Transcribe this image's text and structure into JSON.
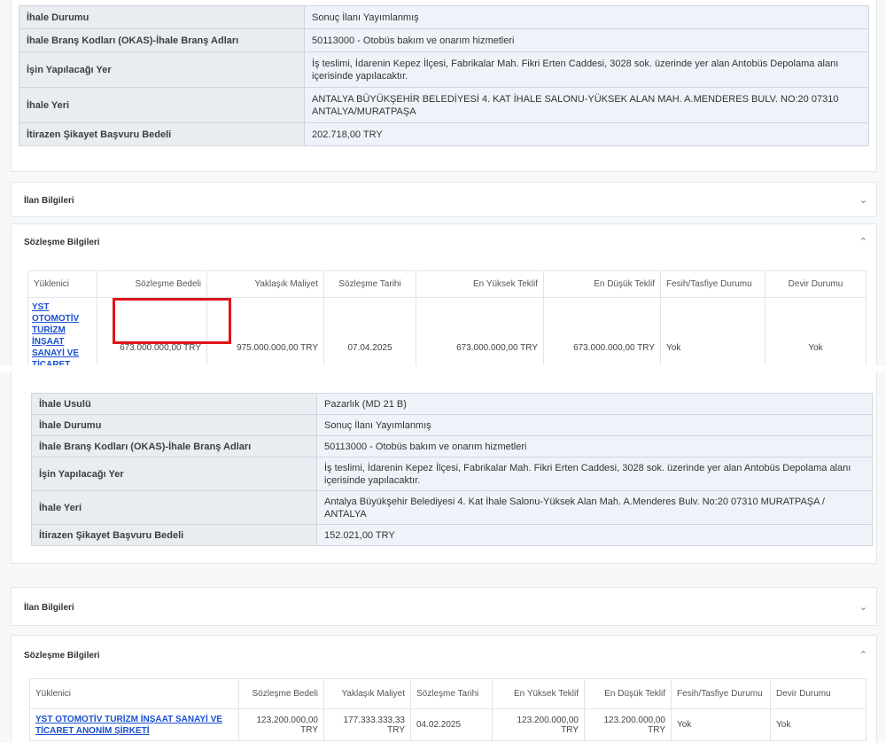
{
  "panel1": {
    "info_rows": [
      {
        "label": "İhale Durumu",
        "value": "Sonuç İlanı Yayımlanmış"
      },
      {
        "label": "İhale Branş Kodları (OKAS)-İhale Branş Adları",
        "value": "50113000 - Otobüs bakım ve onarım hizmetleri"
      },
      {
        "label": "İşin Yapılacağı Yer",
        "value": "İş teslimi, İdarenin Kepez İlçesi, Fabrikalar Mah. Fikri Erten Caddesi, 3028 sok. üzerinde yer alan Antobüs Depolama alanı içerisinde yapılacaktır."
      },
      {
        "label": "İhale Yeri",
        "value": "ANTALYA BÜYÜKŞEHİR BELEDİYESİ 4. KAT İHALE SALONU-YÜKSEK ALAN MAH. A.MENDERES BULV. NO:20 07310 ANTALYA/MURATPAŞA"
      },
      {
        "label": "İtirazen Şikayet Başvuru Bedeli",
        "value": "202.718,00 TRY"
      }
    ],
    "ilan_title": "İlan Bilgileri",
    "sozlesme_title": "Sözleşme Bilgileri",
    "contract_headers": [
      "Yüklenici",
      "Sözleşme Bedeli",
      "Yaklaşık Maliyet",
      "Sözleşme Tarihi",
      "En Yüksek Teklif",
      "En Düşük Teklif",
      "Fesih/Tasfiye Durumu",
      "Devir Durumu"
    ],
    "contract_row": {
      "contractor": "YST OTOMOTİV TURİZM İNŞAAT SANAYİ VE TİCARET ANONİM ŞİRKETİ",
      "contract_price": "673.000.000,00 TRY",
      "approx_cost": "975.000.000,00 TRY",
      "date": "07.04.2025",
      "highest_bid": "673.000.000,00 TRY",
      "lowest_bid": "673.000.000,00 TRY",
      "termination": "Yok",
      "transfer": "Yok"
    }
  },
  "panel2": {
    "info_rows": [
      {
        "label": "İhale Usulü",
        "value": "Pazarlık (MD 21 B)"
      },
      {
        "label": "İhale Durumu",
        "value": "Sonuç İlanı Yayımlanmış"
      },
      {
        "label": "İhale Branş Kodları (OKAS)-İhale Branş Adları",
        "value": "50113000 - Otobüs bakım ve onarım hizmetleri"
      },
      {
        "label": "İşin Yapılacağı Yer",
        "value": "İş teslimi, İdarenin Kepez İlçesi, Fabrikalar Mah. Fikri Erten Caddesi, 3028 sok. üzerinde yer alan Antobüs Depolama alanı içerisinde yapılacaktır."
      },
      {
        "label": "İhale Yeri",
        "value": "Antalya Büyükşehir Belediyesi 4. Kat İhale Salonu-Yüksek Alan Mah. A.Menderes Bulv. No:20 07310 MURATPAŞA / ANTALYA"
      },
      {
        "label": "İtirazen Şikayet Başvuru Bedeli",
        "value": "152.021,00 TRY"
      }
    ],
    "ilan_title": "İlan Bilgileri",
    "sozlesme_title": "Sözleşme Bilgileri",
    "contract_headers": [
      "Yüklenici",
      "Sözleşme Bedeli",
      "Yaklaşık Maliyet",
      "Sözleşme Tarihi",
      "En Yüksek Teklif",
      "En Düşük Teklif",
      "Fesih/Tasfiye Durumu",
      "Devir Durumu"
    ],
    "contract_row": {
      "contractor": "YST OTOMOTİV TURİZM İNŞAAT SANAYİ VE TİCARET ANONİM ŞİRKETİ",
      "contract_price": "123.200.000,00 TRY",
      "approx_cost": "177.333.333,33 TRY",
      "date": "04.02.2025",
      "highest_bid": "123.200.000,00 TRY",
      "lowest_bid": "123.200.000,00 TRY",
      "termination": "Yok",
      "transfer": "Yok"
    }
  },
  "colors": {
    "highlight": "#e0141b",
    "link": "#1a4fd0",
    "label_bg": "#e9ecf0",
    "value_bg": "#eef3f9"
  }
}
